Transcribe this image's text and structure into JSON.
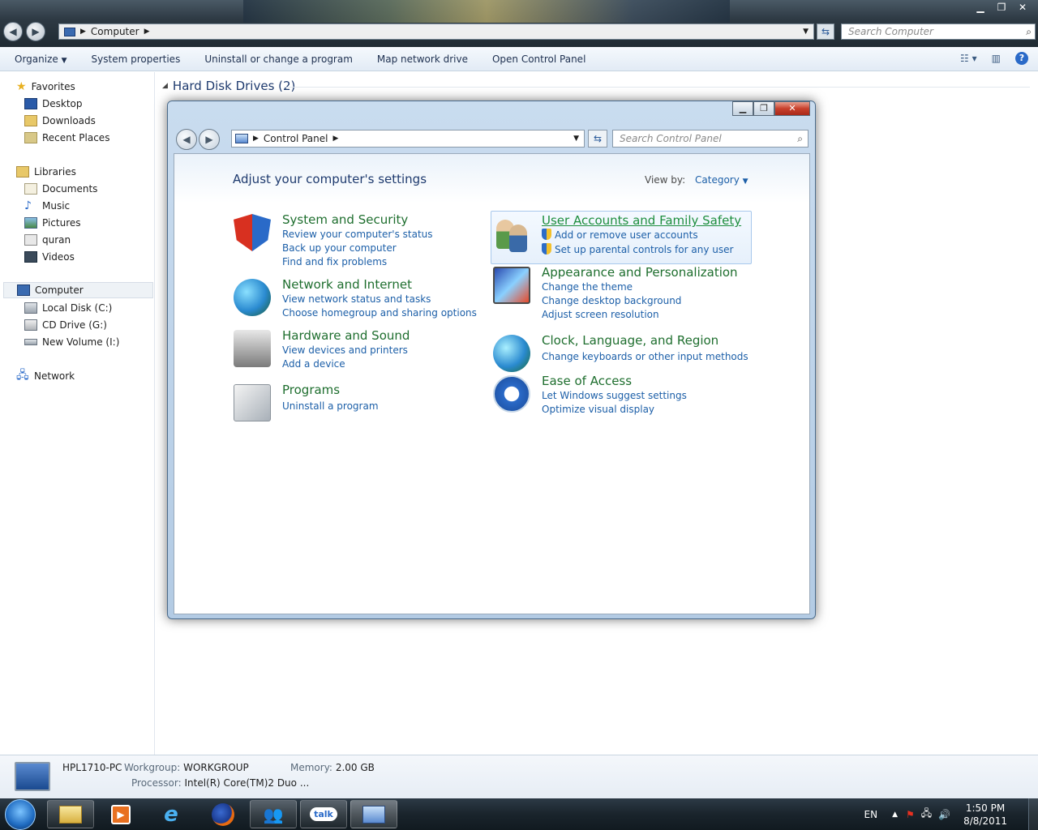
{
  "explorer": {
    "address_crumb": "Computer",
    "search_placeholder": "Search Computer",
    "toolbar": {
      "organize": "Organize",
      "system_properties": "System properties",
      "uninstall": "Uninstall or change a program",
      "map_drive": "Map network drive",
      "open_cp": "Open Control Panel"
    },
    "nav": {
      "favorites": "Favorites",
      "desktop": "Desktop",
      "downloads": "Downloads",
      "recent": "Recent Places",
      "libraries": "Libraries",
      "documents": "Documents",
      "music": "Music",
      "pictures": "Pictures",
      "quran": "quran",
      "videos": "Videos",
      "computer": "Computer",
      "local_disk": "Local Disk (C:)",
      "cd_drive": "CD Drive (G:)",
      "new_volume": "New Volume (I:)",
      "network": "Network"
    },
    "group_header": "Hard Disk Drives (2)",
    "details": {
      "pc_name": "HPL1710-PC",
      "workgroup_label": "Workgroup:",
      "workgroup_value": "WORKGROUP",
      "memory_label": "Memory:",
      "memory_value": "2.00 GB",
      "processor_label": "Processor:",
      "processor_value": "Intel(R) Core(TM)2 Duo ..."
    }
  },
  "control_panel": {
    "address_crumb": "Control Panel",
    "search_placeholder": "Search Control Panel",
    "title": "Adjust your computer's settings",
    "view_by_label": "View by:",
    "view_by_value": "Category",
    "categories": [
      {
        "heading": "System and Security",
        "links": [
          "Review your computer's status",
          "Back up your computer",
          "Find and fix problems"
        ]
      },
      {
        "heading": "Network and Internet",
        "links": [
          "View network status and tasks",
          "Choose homegroup and sharing options"
        ]
      },
      {
        "heading": "Hardware and Sound",
        "links": [
          "View devices and printers",
          "Add a device"
        ]
      },
      {
        "heading": "Programs",
        "links": [
          "Uninstall a program"
        ]
      },
      {
        "heading": "User Accounts and Family Safety",
        "links": [
          "Add or remove user accounts",
          "Set up parental controls for any user"
        ]
      },
      {
        "heading": "Appearance and Personalization",
        "links": [
          "Change the theme",
          "Change desktop background",
          "Adjust screen resolution"
        ]
      },
      {
        "heading": "Clock, Language, and Region",
        "links": [
          "Change keyboards or other input methods"
        ]
      },
      {
        "heading": "Ease of Access",
        "links": [
          "Let Windows suggest settings",
          "Optimize visual display"
        ]
      }
    ]
  },
  "taskbar": {
    "talk_label": "talk",
    "language": "EN",
    "time": "1:50 PM",
    "date": "8/8/2011"
  },
  "colors": {
    "heading_green": "#1e6e2e",
    "link_blue": "#1c5fa8",
    "title_blue": "#1e3a6e"
  }
}
